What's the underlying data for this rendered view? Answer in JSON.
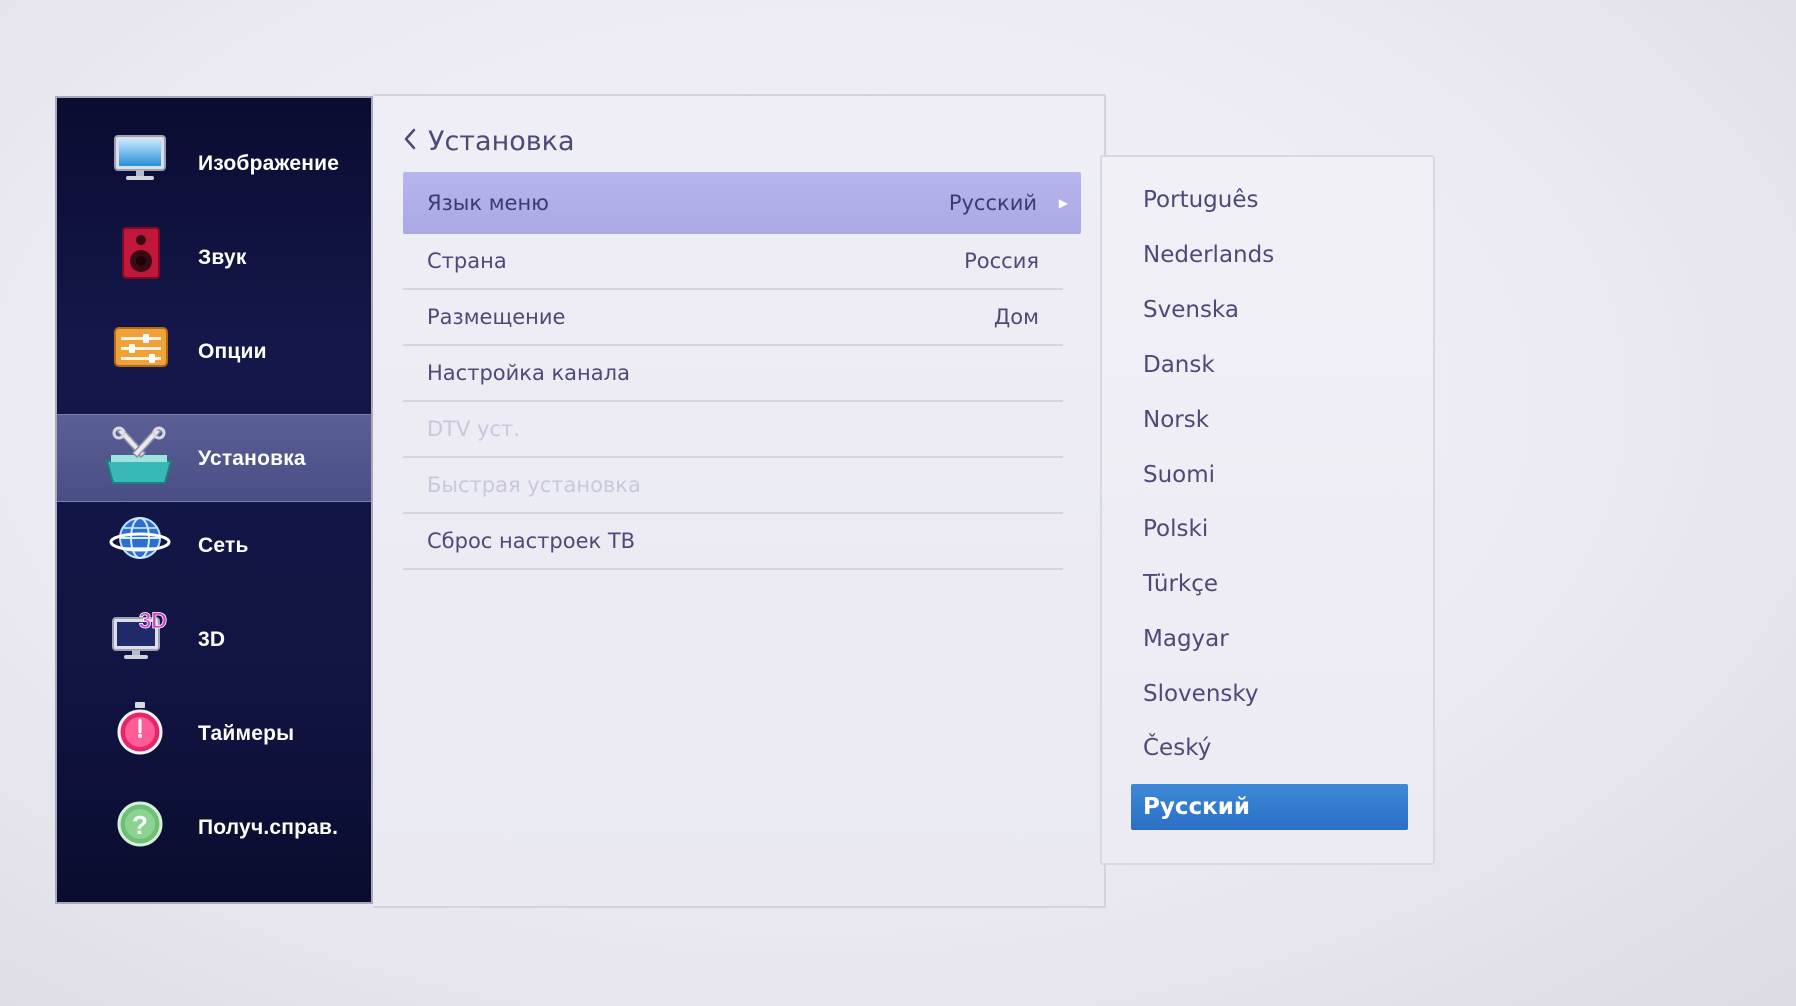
{
  "sidebar": {
    "items": [
      {
        "label": "Изображение",
        "icon": "monitor-icon"
      },
      {
        "label": "Звук",
        "icon": "speaker-icon"
      },
      {
        "label": "Опции",
        "icon": "options-icon"
      },
      {
        "label": "Установка",
        "icon": "tools-icon",
        "selected": true
      },
      {
        "label": "Сеть",
        "icon": "globe-icon"
      },
      {
        "label": "3D",
        "icon": "3d-monitor-icon"
      },
      {
        "label": "Таймеры",
        "icon": "timer-icon"
      },
      {
        "label": "Получ.справ.",
        "icon": "help-icon"
      }
    ]
  },
  "main": {
    "title": "Установка",
    "rows": [
      {
        "label": "Язык меню",
        "value": "Русский",
        "selected": true
      },
      {
        "label": "Страна",
        "value": "Россия"
      },
      {
        "label": "Размещение",
        "value": "Дом"
      },
      {
        "label": "Настройка канала",
        "value": ""
      },
      {
        "label": "DTV уст.",
        "value": "",
        "disabled": true
      },
      {
        "label": "Быстрая установка",
        "value": "",
        "disabled": true
      },
      {
        "label": "Сброс настроек ТВ",
        "value": ""
      }
    ]
  },
  "language_list": {
    "items": [
      "Português",
      "Nederlands",
      "Svenska",
      "Dansk",
      "Norsk",
      "Suomi",
      "Polski",
      "Türkçe",
      "Magyar",
      "Slovensky",
      "Český",
      "Русский"
    ],
    "selected": "Русский"
  },
  "colors": {
    "sidebar_bg": "#14174a",
    "sidebar_selected": "#494e86",
    "row_selected": "#aaa9e6",
    "lang_selected": "#2c6ec4",
    "text": "#4d4a78"
  }
}
